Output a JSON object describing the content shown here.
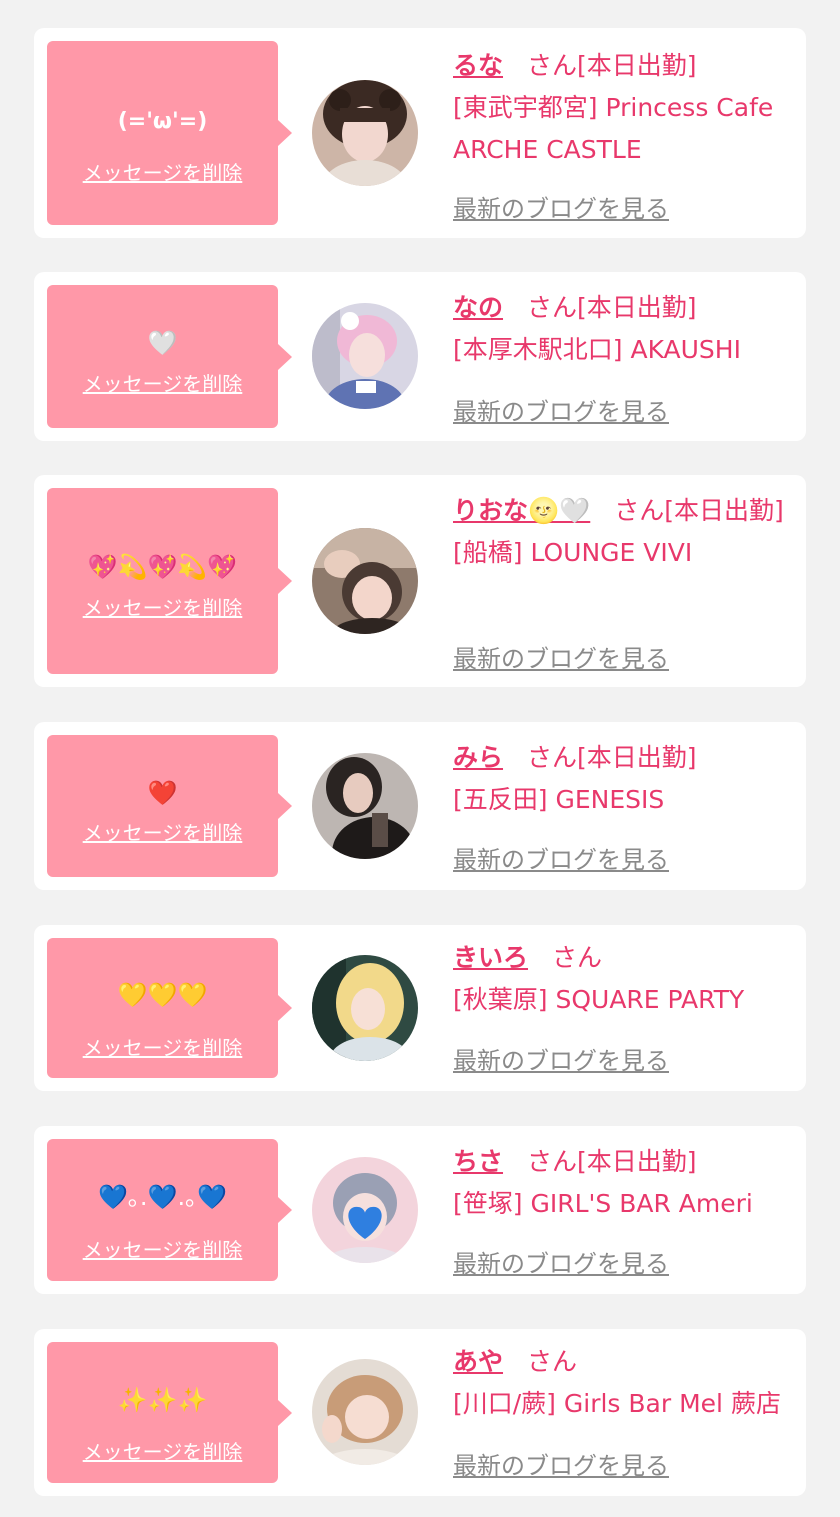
{
  "theme": {
    "bubble": "#ff98a8",
    "accent": "#e8386b",
    "muted": "#8a8a8a",
    "card": "#ffffff",
    "background": "#f2f2f2"
  },
  "items": [
    {
      "message": "(='ω'=)",
      "delete_label": "メッセージを削除",
      "avatar": "cast-photo-avatar",
      "name": "るな",
      "honorific": "さん",
      "status": "[本日出勤]",
      "area": "[東武宇都宮]",
      "shop": "Princess Cafe ARCHE CASTLE",
      "blog_label": "最新のブログを見る"
    },
    {
      "message": "🤍",
      "delete_label": "メッセージを削除",
      "avatar": "cast-photo-avatar",
      "name": "なの",
      "honorific": "さん",
      "status": "[本日出勤]",
      "area": "[本厚木駅北口]",
      "shop": "AKAUSHI",
      "blog_label": "最新のブログを見る"
    },
    {
      "message": "💖💫💖💫💖",
      "delete_label": "メッセージを削除",
      "avatar": "cast-photo-avatar",
      "name": "りおな🌝🤍",
      "honorific": "さん",
      "status": "[本日出勤]",
      "area": "[船橋]",
      "shop": "LOUNGE VIVI",
      "blog_label": "最新のブログを見る"
    },
    {
      "message": "❤️",
      "delete_label": "メッセージを削除",
      "avatar": "cast-photo-avatar",
      "name": "みら",
      "honorific": "さん",
      "status": "[本日出勤]",
      "area": "[五反田]",
      "shop": "GENESIS",
      "blog_label": "最新のブログを見る"
    },
    {
      "message": "💛💛💛",
      "delete_label": "メッセージを削除",
      "avatar": "cast-photo-avatar",
      "name": "きいろ",
      "honorific": "さん",
      "status": "",
      "area": "[秋葉原]",
      "shop": "SQUARE PARTY",
      "blog_label": "最新のブログを見る"
    },
    {
      "message": "💙｡.💙.｡💙",
      "delete_label": "メッセージを削除",
      "avatar": "cast-photo-avatar",
      "name": "ちさ",
      "honorific": "さん",
      "status": "[本日出勤]",
      "area": "[笹塚]",
      "shop": "GIRL'S BAR Ameri",
      "blog_label": "最新のブログを見る"
    },
    {
      "message": "✨✨✨",
      "delete_label": "メッセージを削除",
      "avatar": "cast-photo-avatar",
      "name": "あや",
      "honorific": "さん",
      "status": "",
      "area": "[川口/蕨]",
      "shop": "Girls Bar Mel 蕨店",
      "blog_label": "最新のブログを見る"
    }
  ]
}
